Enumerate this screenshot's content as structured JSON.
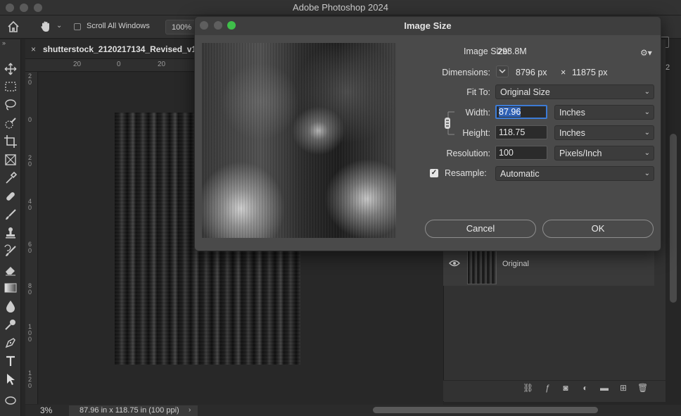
{
  "app": {
    "title": "Adobe Photoshop 2024"
  },
  "options_bar": {
    "scroll_all_windows_label": "Scroll All Windows",
    "zoom_value": "100%"
  },
  "document": {
    "tab_name": "shutterstock_2120217134_Revised_v1",
    "tab_close": "×"
  },
  "rulers": {
    "top_labels": [
      "20",
      "0",
      "20"
    ],
    "left_labels": [
      "2\n0",
      "0",
      "2\n0",
      "4\n0",
      "6\n0",
      "8\n0",
      "1\n0\n0",
      "1\n2\n0"
    ]
  },
  "status": {
    "zoom": "3%",
    "doc_info": "87.96 in x 118.75 in (100 ppi)",
    "arrow": "›"
  },
  "layers": {
    "layer_name": "Original",
    "right_panel_number": "2"
  },
  "dialog": {
    "title": "Image Size",
    "image_size_label": "Image Size:",
    "image_size_value": "298.8M",
    "dimensions_label": "Dimensions:",
    "dimensions_width": "8796 px",
    "dimensions_times": "×",
    "dimensions_height": "11875 px",
    "fit_to_label": "Fit To:",
    "fit_to_value": "Original Size",
    "width_label": "Width:",
    "width_value": "87.96",
    "width_unit": "Inches",
    "height_label": "Height:",
    "height_value": "118.75",
    "height_unit": "Inches",
    "resolution_label": "Resolution:",
    "resolution_value": "100",
    "resolution_unit": "Pixels/Inch",
    "resample_label": "Resample:",
    "resample_checked": true,
    "resample_value": "Automatic",
    "cancel_label": "Cancel",
    "ok_label": "OK"
  },
  "colors": {
    "accent": "#3c7bd6",
    "window_bg": "#262626",
    "dialog_bg": "#4a4a4a",
    "green_dot": "#3fbf4a"
  }
}
